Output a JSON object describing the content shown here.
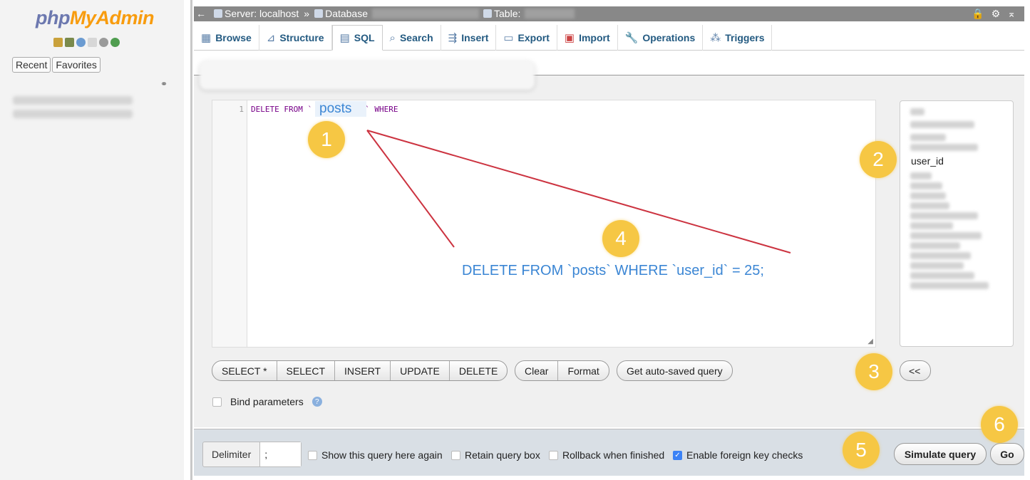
{
  "sidebar": {
    "logo_part1": "php",
    "logo_part2": "MyAdmin",
    "recent_label": "Recent",
    "favorites_label": "Favorites"
  },
  "topbar": {
    "server_label": "Server: localhost",
    "separator": "»",
    "database_label": "Database",
    "table_label": "Table:"
  },
  "tabs": [
    {
      "label": "Browse",
      "icon": "browse-icon"
    },
    {
      "label": "Structure",
      "icon": "structure-icon"
    },
    {
      "label": "SQL",
      "icon": "sql-icon"
    },
    {
      "label": "Search",
      "icon": "search-icon"
    },
    {
      "label": "Insert",
      "icon": "insert-icon"
    },
    {
      "label": "Export",
      "icon": "export-icon"
    },
    {
      "label": "Import",
      "icon": "import-icon"
    },
    {
      "label": "Operations",
      "icon": "wrench-icon"
    },
    {
      "label": "Triggers",
      "icon": "triggers-icon"
    }
  ],
  "editor": {
    "line_number": "1",
    "code_part1": "DELETE FROM `",
    "code_part2": "` WHERE",
    "table_name": "posts"
  },
  "columns": {
    "visible_column": "user_id"
  },
  "query_buttons": [
    "SELECT *",
    "SELECT",
    "INSERT",
    "UPDATE",
    "DELETE"
  ],
  "edit_buttons": [
    "Clear",
    "Format"
  ],
  "autosave_button": "Get auto-saved query",
  "collapse_button": "<<",
  "bind_parameters_label": "Bind parameters",
  "bottom": {
    "delimiter_label": "Delimiter",
    "delimiter_value": ";",
    "show_query_label": "Show this query here again",
    "retain_box_label": "Retain query box",
    "rollback_label": "Rollback when finished",
    "fk_checks_label": "Enable foreign key checks",
    "simulate_button": "Simulate query",
    "go_button": "Go"
  },
  "annotations": {
    "badges": [
      "1",
      "2",
      "3",
      "4",
      "5",
      "6"
    ],
    "final_query": "DELETE FROM `posts` WHERE `user_id` = 25;",
    "color": "#f6c744",
    "line_color": "#cc3340",
    "text_color": "#3b86d4"
  }
}
